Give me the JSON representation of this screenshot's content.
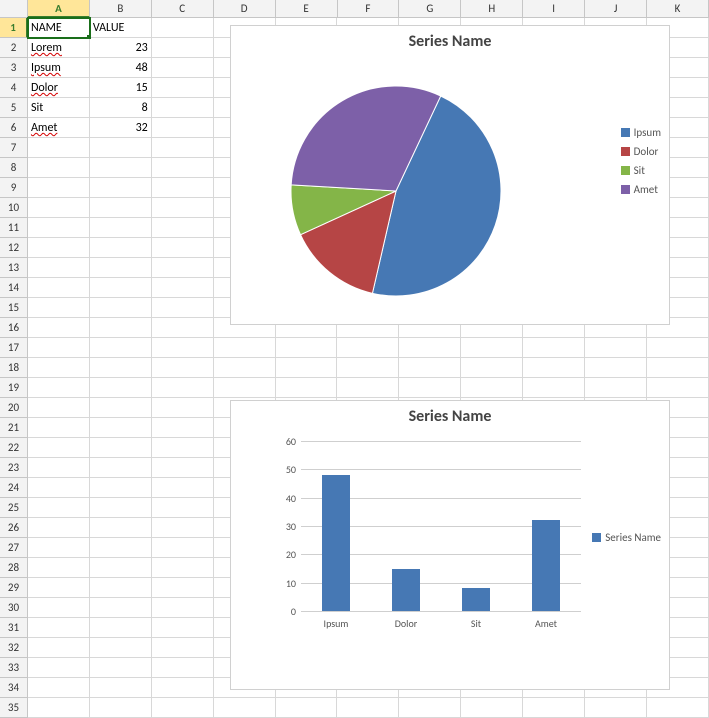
{
  "columns": [
    "A",
    "B",
    "C",
    "D",
    "E",
    "F",
    "G",
    "H",
    "I",
    "J",
    "K"
  ],
  "row_count": 35,
  "active_cell": "A1",
  "table": {
    "headers": {
      "A": "NAME",
      "B": "VALUE"
    },
    "rows": [
      {
        "name": "Lorem",
        "value": 23
      },
      {
        "name": "Ipsum",
        "value": 48
      },
      {
        "name": "Dolor",
        "value": 15
      },
      {
        "name": "Sit",
        "value": 8
      },
      {
        "name": "Amet",
        "value": 32
      }
    ]
  },
  "pie": {
    "title": "Series Name",
    "legend": [
      {
        "label": "Ipsum",
        "color": "#4678b4"
      },
      {
        "label": "Dolor",
        "color": "#b64545"
      },
      {
        "label": "Sit",
        "color": "#84b548"
      },
      {
        "label": "Amet",
        "color": "#7d60a8"
      }
    ]
  },
  "bar": {
    "title": "Series Name",
    "legend": [
      {
        "label": "Series Name",
        "color": "#4678b4"
      }
    ],
    "y_ticks": [
      0,
      10,
      20,
      30,
      40,
      50,
      60
    ],
    "categories": [
      "Ipsum",
      "Dolor",
      "Sit",
      "Amet"
    ]
  },
  "chart_data": [
    {
      "type": "pie",
      "title": "Series Name",
      "categories": [
        "Ipsum",
        "Dolor",
        "Sit",
        "Amet"
      ],
      "values": [
        48,
        15,
        8,
        32
      ],
      "colors": [
        "#4678b4",
        "#b64545",
        "#84b548",
        "#7d60a8"
      ],
      "legend_position": "right"
    },
    {
      "type": "bar",
      "title": "Series Name",
      "categories": [
        "Ipsum",
        "Dolor",
        "Sit",
        "Amet"
      ],
      "series": [
        {
          "name": "Series Name",
          "values": [
            48,
            15,
            8,
            32
          ],
          "color": "#4678b4"
        }
      ],
      "xlabel": "",
      "ylabel": "",
      "ylim": [
        0,
        60
      ],
      "y_ticks": [
        0,
        10,
        20,
        30,
        40,
        50,
        60
      ],
      "grid": true,
      "legend_position": "right"
    }
  ]
}
